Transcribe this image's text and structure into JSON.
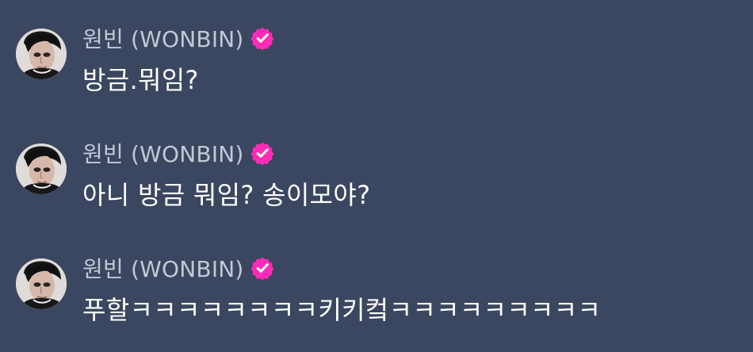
{
  "messages": [
    {
      "sender": "원빈 (WONBIN)",
      "text": "방금.뭐임?"
    },
    {
      "sender": "원빈 (WONBIN)",
      "text": "아니 방금 뭐임? 송이모야?"
    },
    {
      "sender": "원빈 (WONBIN)",
      "text": "푸할ㅋㅋㅋㅋㅋㅋㅋㅋ키키컼ㅋㅋㅋㅋㅋㅋㅋㅋㅋ"
    }
  ],
  "colors": {
    "background": "#3b4660",
    "sender": "#c3c8d4",
    "message": "#ffffff",
    "verified_badge": "#ff2bb5"
  },
  "icons": {
    "avatar": "profile-photo",
    "badge": "verified-badge-icon"
  }
}
